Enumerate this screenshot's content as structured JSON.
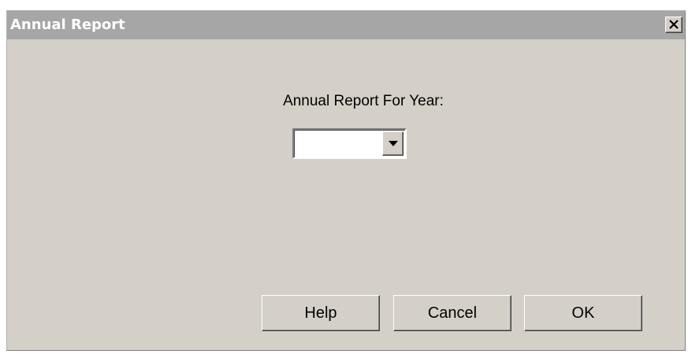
{
  "window": {
    "title": "Annual Report",
    "close_glyph": "✕"
  },
  "form": {
    "year_label": "Annual Report For Year:",
    "year_value": ""
  },
  "buttons": {
    "help": "Help",
    "cancel": "Cancel",
    "ok": "OK"
  },
  "icons": {
    "close": "close-icon",
    "dropdown": "chevron-down-icon"
  },
  "colors": {
    "titlebar": "#a6a6a6",
    "dialog_face": "#d4d0c8"
  }
}
